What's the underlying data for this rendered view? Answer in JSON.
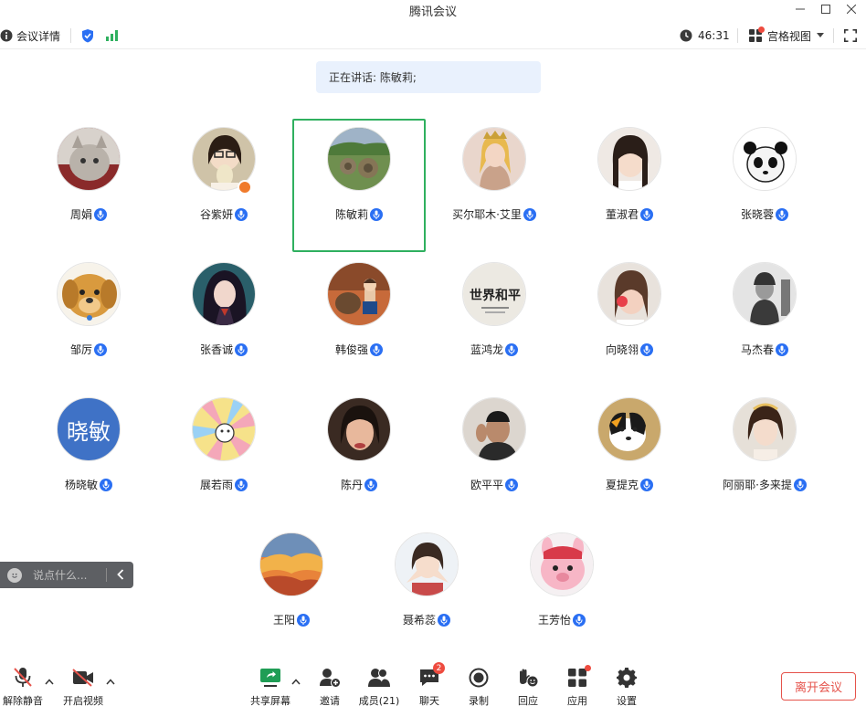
{
  "window": {
    "title": "腾讯会议"
  },
  "toolbar": {
    "meeting_info_label": "会议详情",
    "timer": "46:31",
    "view_label": "宫格视图"
  },
  "speaking": {
    "text": "正在讲话: 陈敏莉;"
  },
  "participants": [
    {
      "name": "周娟"
    },
    {
      "name": "谷紫妍"
    },
    {
      "name": "陈敏莉"
    },
    {
      "name": "买尔耶木·艾里"
    },
    {
      "name": "董淑君"
    },
    {
      "name": "张晓蓉"
    },
    {
      "name": "邹厉"
    },
    {
      "name": "张香诚"
    },
    {
      "name": "韩俊强"
    },
    {
      "name": "蓝鸿龙"
    },
    {
      "name": "向晓翎"
    },
    {
      "name": "马杰春"
    },
    {
      "name": "杨晓敏",
      "avatar_text": "晓敏"
    },
    {
      "name": "展若雨"
    },
    {
      "name": "陈丹"
    },
    {
      "name": "欧平平"
    },
    {
      "name": "夏提克"
    },
    {
      "name": "阿丽耶·多来提"
    },
    {
      "name": "王阳"
    },
    {
      "name": "聂希蕊"
    },
    {
      "name": "王芳怡"
    }
  ],
  "avatar_texts": {
    "p9": "世界和平"
  },
  "chat": {
    "placeholder": "说点什么..."
  },
  "bottombar": {
    "unmute": "解除静音",
    "start_video": "开启视频",
    "share_screen": "共享屏幕",
    "invite": "邀请",
    "members": "成员(21)",
    "chat": "聊天",
    "chat_badge": "2",
    "record": "录制",
    "react": "回应",
    "apps": "应用",
    "settings": "设置",
    "leave": "离开会议"
  },
  "colors": {
    "accent_blue": "#2a6ff3",
    "active_border": "#2fb05f",
    "leave_red": "#e5534b",
    "banner_bg": "#e9f1fd"
  }
}
